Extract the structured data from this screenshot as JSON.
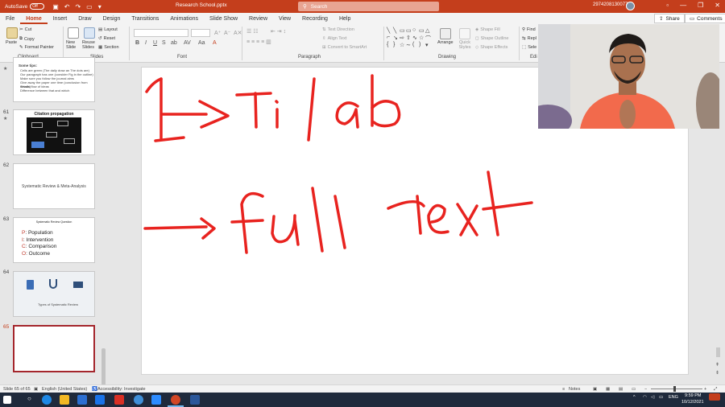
{
  "titlebar": {
    "autosave_label": "AutoSave",
    "autosave_state": "Off",
    "filename": "Research School.pptx",
    "search_placeholder": "Search",
    "account": "2974208130077"
  },
  "tabs": [
    "File",
    "Home",
    "Insert",
    "Draw",
    "Design",
    "Transitions",
    "Animations",
    "Slide Show",
    "Review",
    "View",
    "Recording",
    "Help"
  ],
  "active_tab": "Home",
  "share_label": "Share",
  "comments_label": "Comments",
  "ribbon": {
    "clipboard": {
      "paste": "Paste",
      "cut": "Cut",
      "copy": "Copy",
      "format_painter": "Format Painter",
      "label": "Clipboard"
    },
    "slides": {
      "new_slide": "New Slide",
      "reuse_slides": "Reuse Slides",
      "layout": "Layout",
      "reset": "Reset",
      "section": "Section",
      "label": "Slides"
    },
    "font": {
      "label": "Font",
      "bold": "B",
      "italic": "I",
      "underline": "U",
      "strike": "S",
      "shadow": "ab",
      "spacing": "AV",
      "case": "Aa",
      "color": "A"
    },
    "paragraph": {
      "label": "Paragraph",
      "text_direction": "Text Direction",
      "align_text": "Align Text",
      "smartart": "Convert to SmartArt"
    },
    "drawing": {
      "label": "Drawing",
      "arrange": "Arrange",
      "quick_styles": "Quick Styles",
      "shape_fill": "Shape Fill",
      "shape_outline": "Shape Outline",
      "shape_effects": "Shape Effects"
    },
    "editing": {
      "label": "Edi",
      "find": "Find",
      "replace": "Repl",
      "select": "Sele"
    }
  },
  "slides": [
    {
      "number": "",
      "title": "Some tips:",
      "lines": [
        "Cells are green (The daily draw an The dots are)",
        "Our paragraph has one (consider Fig in the outline)",
        "Make sure you follow the journal aims",
        "Give away the paper one time (conclusion from details)",
        "Should flow of ideas",
        "Difference between that and which"
      ]
    },
    {
      "number": "61",
      "title": "Citation propagation"
    },
    {
      "number": "62",
      "title": "Systematic Review & Meta-Analysis"
    },
    {
      "number": "63",
      "title": "Systematic Review Question",
      "pico": [
        {
          "letter": "P",
          "text": ": Population"
        },
        {
          "letter": "I",
          "text": ": Intervention"
        },
        {
          "letter": "C",
          "text": ": Comparison"
        },
        {
          "letter": "O",
          "text": ": Outcome"
        }
      ]
    },
    {
      "number": "64",
      "title": "Types of Systematic Review"
    },
    {
      "number": "65",
      "title": ""
    }
  ],
  "colors": {
    "accent": "#c43e1c",
    "ink": "#e8231f",
    "pico_letter": "#c0392b"
  },
  "status": {
    "slide_info": "Slide 65 of 65",
    "language": "English (United States)",
    "accessibility": "Accessibility: Investigate",
    "notes": "Notes"
  },
  "taskbar": {
    "language": "ENG",
    "time": "9:59 PM",
    "date": "10/12/2021"
  }
}
